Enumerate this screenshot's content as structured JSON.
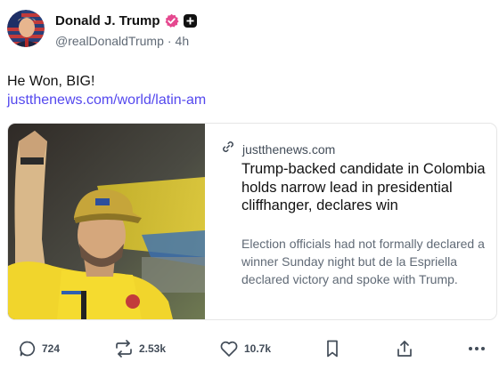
{
  "author": {
    "display_name": "Donald J. Trump",
    "handle": "@realDonaldTrump",
    "separator": "·",
    "time_ago": "4h"
  },
  "post": {
    "text": "He Won, BIG!",
    "link_text": "justthenews.com/world/latin-am"
  },
  "card": {
    "domain": "justthenews.com",
    "title": "Trump-backed candidate in Colombia holds narrow lead in presidential cliffhanger, declares win",
    "description": "Election officials had not formally declared a winner Sunday night but de la Espriella declared victory and spoke with Trump."
  },
  "actions": {
    "replies": "724",
    "reposts": "2.53k",
    "likes": "10.7k"
  },
  "icons": [
    "verified-badge-icon",
    "add-icon",
    "link-icon",
    "reply-icon",
    "repost-icon",
    "like-icon",
    "bookmark-icon",
    "share-icon",
    "more-icon"
  ],
  "colors": {
    "link": "#5448ee",
    "verified_badge": "#e5488f",
    "muted_text": "#606a76",
    "icon": "#424c58"
  }
}
